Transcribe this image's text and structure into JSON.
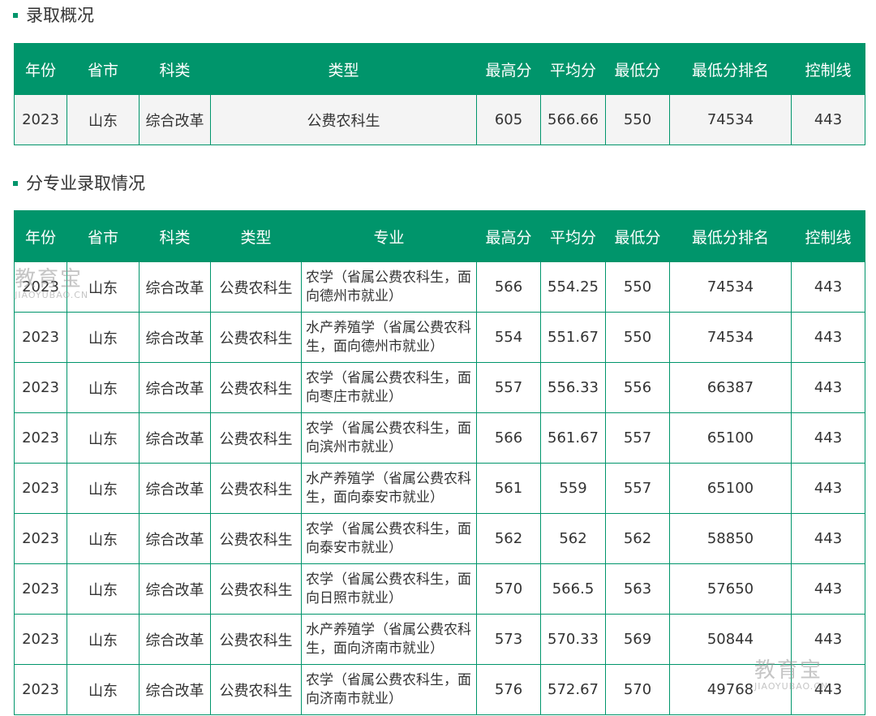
{
  "section1": {
    "title": "录取概况",
    "headers": [
      "年份",
      "省市",
      "科类",
      "类型",
      "最高分",
      "平均分",
      "最低分",
      "最低分排名",
      "控制线"
    ],
    "rows": [
      [
        "2023",
        "山东",
        "综合改革",
        "公费农科生",
        "605",
        "566.66",
        "550",
        "74534",
        "443"
      ]
    ]
  },
  "section2": {
    "title": "分专业录取情况",
    "headers": [
      "年份",
      "省市",
      "科类",
      "类型",
      "专业",
      "最高分",
      "平均分",
      "最低分",
      "最低分排名",
      "控制线"
    ],
    "rows": [
      [
        "2023",
        "山东",
        "综合改革",
        "公费农科生",
        "农学（省属公费农科生，面向德州市就业）",
        "566",
        "554.25",
        "550",
        "74534",
        "443"
      ],
      [
        "2023",
        "山东",
        "综合改革",
        "公费农科生",
        "水产养殖学（省属公费农科生，面向德州市就业）",
        "554",
        "551.67",
        "550",
        "74534",
        "443"
      ],
      [
        "2023",
        "山东",
        "综合改革",
        "公费农科生",
        "农学（省属公费农科生，面向枣庄市就业）",
        "557",
        "556.33",
        "556",
        "66387",
        "443"
      ],
      [
        "2023",
        "山东",
        "综合改革",
        "公费农科生",
        "农学（省属公费农科生，面向滨州市就业）",
        "566",
        "561.67",
        "557",
        "65100",
        "443"
      ],
      [
        "2023",
        "山东",
        "综合改革",
        "公费农科生",
        "水产养殖学（省属公费农科生，面向泰安市就业）",
        "561",
        "559",
        "557",
        "65100",
        "443"
      ],
      [
        "2023",
        "山东",
        "综合改革",
        "公费农科生",
        "农学（省属公费农科生，面向泰安市就业）",
        "562",
        "562",
        "562",
        "58850",
        "443"
      ],
      [
        "2023",
        "山东",
        "综合改革",
        "公费农科生",
        "农学（省属公费农科生，面向日照市就业）",
        "570",
        "566.5",
        "563",
        "57650",
        "443"
      ],
      [
        "2023",
        "山东",
        "综合改革",
        "公费农科生",
        "水产养殖学（省属公费农科生，面向济南市就业）",
        "573",
        "570.33",
        "569",
        "50844",
        "443"
      ],
      [
        "2023",
        "山东",
        "综合改革",
        "公费农科生",
        "农学（省属公费农科生，面向济南市就业）",
        "576",
        "572.67",
        "570",
        "49768",
        "443"
      ]
    ]
  },
  "watermark": {
    "main": "教育宝",
    "sub": "JIAOYUBAO.CN"
  },
  "colors": {
    "accent": "#00956b",
    "row_bg_summary": "#f4f4f4"
  }
}
